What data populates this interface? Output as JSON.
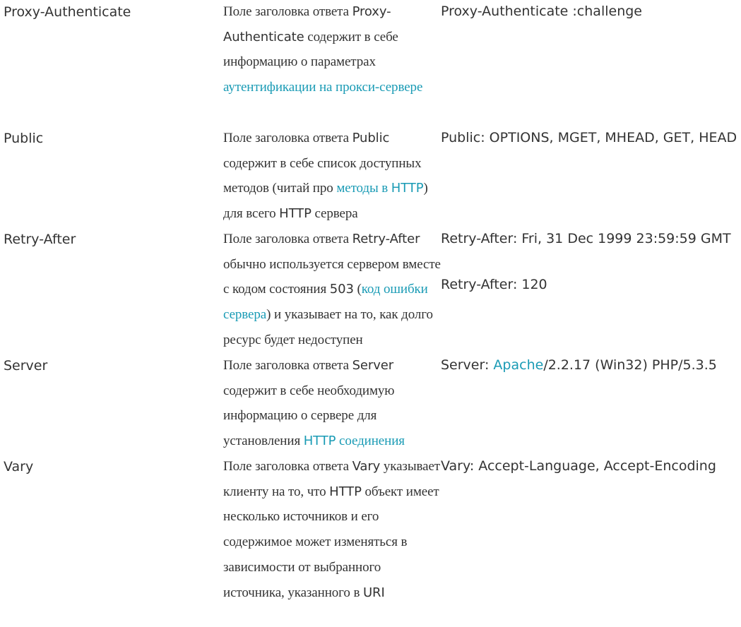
{
  "rows": [
    {
      "name": "Proxy-Authenticate",
      "desc": [
        {
          "t": "Поле заголовка ответа ",
          "k": "serif"
        },
        {
          "t": "Proxy-Authenticate",
          "k": "sans"
        },
        {
          "t": " содержит в себе информацию о параметрах ",
          "k": "serif"
        },
        {
          "t": "аутентификации на прокси-сервере",
          "k": "link"
        }
      ],
      "example": [
        "Proxy-Authenticate  :challenge"
      ]
    },
    {
      "name": "Public",
      "desc": [
        {
          "t": "Поле заголовка ответа ",
          "k": "serif"
        },
        {
          "t": "Public",
          "k": "sans"
        },
        {
          "t": " содержит в себе список доступных методов (читай про ",
          "k": "serif"
        },
        {
          "t": "методы в ",
          "k": "link"
        },
        {
          "t": "HTTP",
          "k": "linksans"
        },
        {
          "t": ") для всего ",
          "k": "serif"
        },
        {
          "t": "HTTP",
          "k": "sans"
        },
        {
          "t": " сервера",
          "k": "serif"
        }
      ],
      "example": [
        "Public: OPTIONS, MGET, MHEAD, GET, HEAD"
      ]
    },
    {
      "name": "Retry-After",
      "desc": [
        {
          "t": "Поле заголовка ответа ",
          "k": "serif"
        },
        {
          "t": "Retry-After",
          "k": "sans"
        },
        {
          "t": " обычно используется сервером вместе с кодом состояния ",
          "k": "serif"
        },
        {
          "t": "503",
          "k": "sans"
        },
        {
          "t": " (",
          "k": "serif"
        },
        {
          "t": "код ошибки сервера",
          "k": "link"
        },
        {
          "t": ") и указывает на то, как долго ресурс будет недоступен",
          "k": "serif"
        }
      ],
      "example": [
        "Retry-After: Fri, 31 Dec 1999 23:59:59 GMT",
        "Retry-After: 120"
      ]
    },
    {
      "name": "Server",
      "desc": [
        {
          "t": "Поле заголовка ответа ",
          "k": "serif"
        },
        {
          "t": "Server",
          "k": "sans"
        },
        {
          "t": " содержит в себе необходимую информацию о сервере для установления ",
          "k": "serif"
        },
        {
          "t": "HTTP",
          "k": "linksans"
        },
        {
          "t": " соединения",
          "k": "link"
        }
      ],
      "example_parts": [
        {
          "t": "Server: ",
          "k": "plain"
        },
        {
          "t": "Apache",
          "k": "link"
        },
        {
          "t": "/2.2.17 (Win32) PHP/5.3.5",
          "k": "plain"
        }
      ]
    },
    {
      "name": "Vary",
      "desc": [
        {
          "t": "Поле заголовка ответа ",
          "k": "serif"
        },
        {
          "t": "Vary",
          "k": "sans"
        },
        {
          "t": " указывает клиенту на то, что ",
          "k": "serif"
        },
        {
          "t": "HTTP",
          "k": "sans"
        },
        {
          "t": " объект имеет несколько источников и его содержимое может изменяться в зависимости от выбранного источника, указанного в ",
          "k": "serif"
        },
        {
          "t": "URI",
          "k": "sans"
        }
      ],
      "example": [
        "Vary: Accept-Language, Accept-Encoding"
      ]
    }
  ],
  "colors": {
    "text": "#333333",
    "link": "#1a9bb5"
  }
}
